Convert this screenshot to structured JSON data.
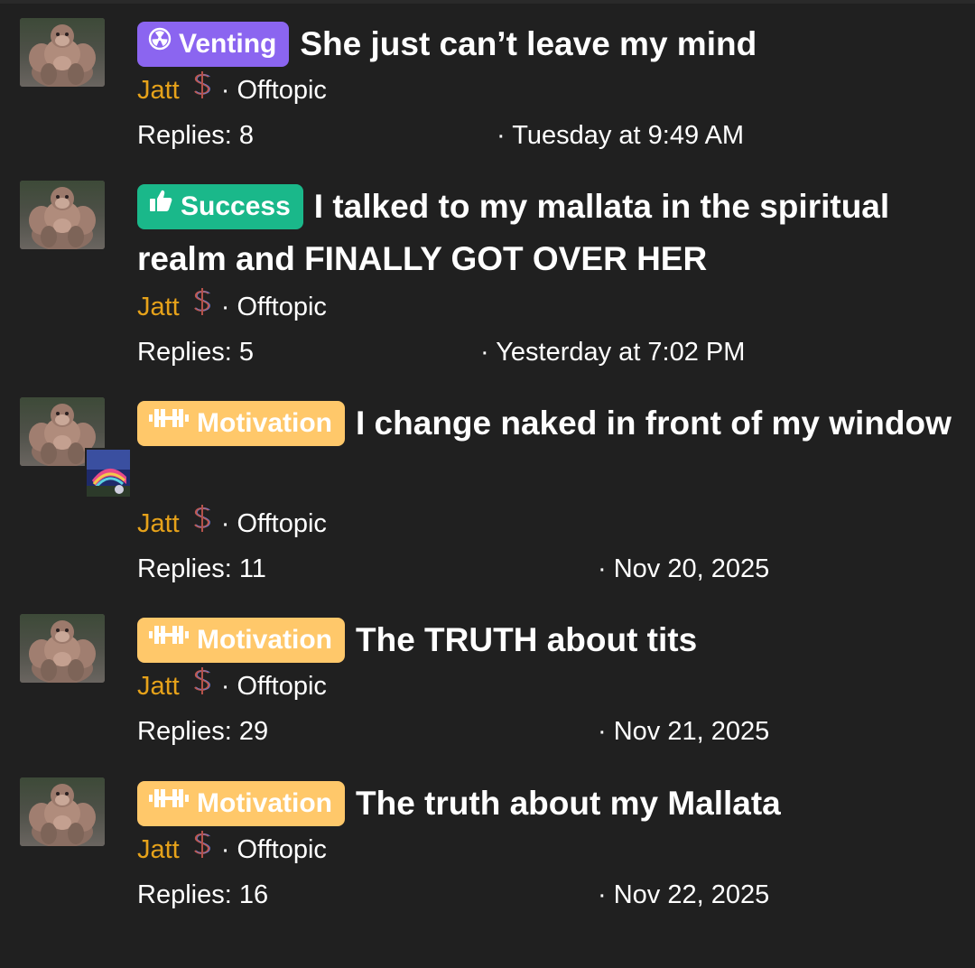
{
  "threads": [
    {
      "badge": "Venting",
      "badge_icon": "radiation-icon",
      "badge_color": "#8b65f0",
      "title": "She just can’t leave my mind",
      "author": "Jatt",
      "forum": "Offtopic",
      "replies": "Replies: 8",
      "date": "Tuesday at 9:49 AM"
    },
    {
      "badge": "Success",
      "badge_icon": "thumbs-up-icon",
      "badge_color": "#1ab88a",
      "title": "I talked to my mallata in the spiritual realm and FINALLY GOT OVER HER",
      "author": "Jatt",
      "forum": "Offtopic",
      "replies": "Replies: 5",
      "date": "Yesterday at 7:02 PM"
    },
    {
      "badge": "Motivation",
      "badge_icon": "dumbbell-icon",
      "badge_color": "#ffc86a",
      "title": "I change naked in front of my window",
      "author": "Jatt",
      "forum": "Offtopic",
      "replies": "Replies: 11",
      "date": "Nov 20, 2025"
    },
    {
      "badge": "Motivation",
      "badge_icon": "dumbbell-icon",
      "badge_color": "#ffc86a",
      "title": "The TRUTH about tits",
      "author": "Jatt",
      "forum": "Offtopic",
      "replies": "Replies: 29",
      "date": "Nov 21, 2025"
    },
    {
      "badge": "Motivation",
      "badge_icon": "dumbbell-icon",
      "badge_color": "#ffc86a",
      "title": "The truth about my Mallata",
      "author": "Jatt",
      "forum": "Offtopic",
      "replies": "Replies: 16",
      "date": "Nov 22, 2025"
    }
  ],
  "separator": "·",
  "author_color": "#e6a21a",
  "author_badge_icon": "dollar-sign-icon"
}
